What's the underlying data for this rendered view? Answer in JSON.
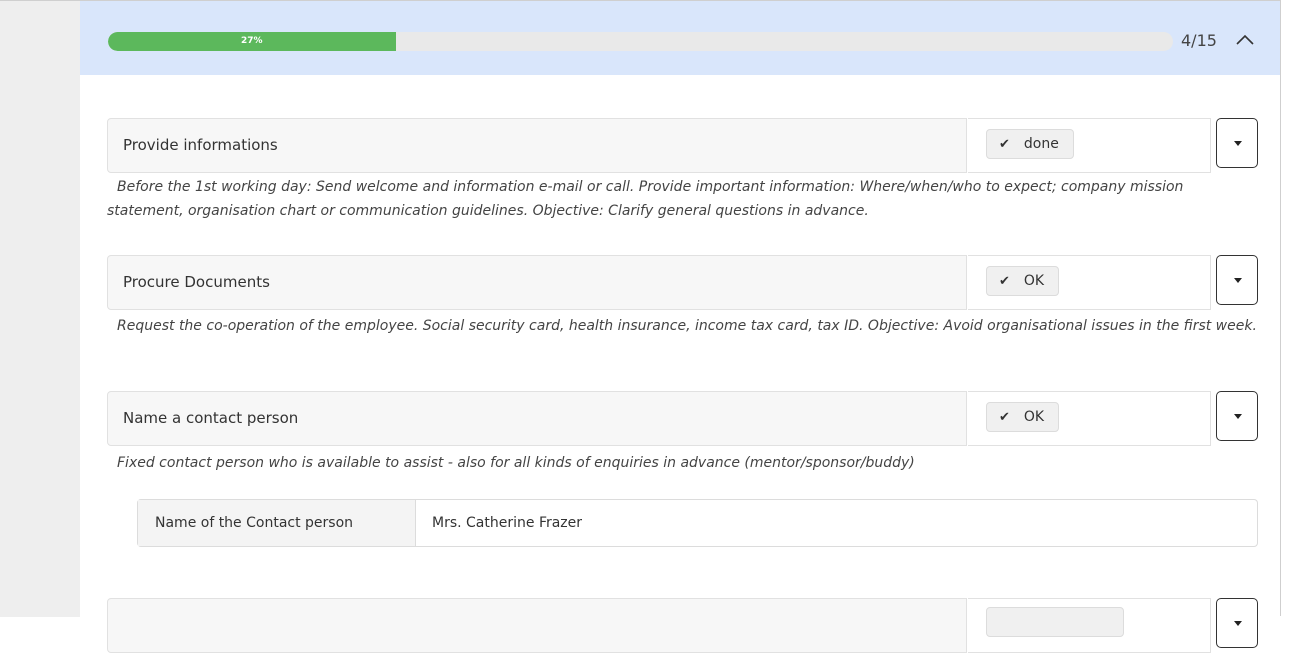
{
  "progress": {
    "percent_label": "27%",
    "percent": 27,
    "count": "4/15"
  },
  "tasks": [
    {
      "name": "Provide informations",
      "status": "done",
      "description": "Before the 1st working day: Send welcome and information e-mail or call. Provide important information: Where/when/who to expect; company mission statement, organisation chart or communication guidelines. Objective: Clarify general questions in advance."
    },
    {
      "name": "Procure Documents",
      "status": "OK",
      "description": "Request the co-operation of the employee. Social security card, health insurance, income tax card, tax ID. Objective: Avoid organisational issues in the first week."
    },
    {
      "name": "Name a contact person",
      "status": "OK",
      "description": "Fixed contact person who is available to assist - also for all kinds of enquiries in advance (mentor/sponsor/buddy)"
    }
  ],
  "contact_field": {
    "label": "Name of the Contact person",
    "value": "Mrs. Catherine Frazer"
  },
  "colors": {
    "header_bg": "#d9e6fb",
    "progress_fill": "#5cb85c"
  }
}
